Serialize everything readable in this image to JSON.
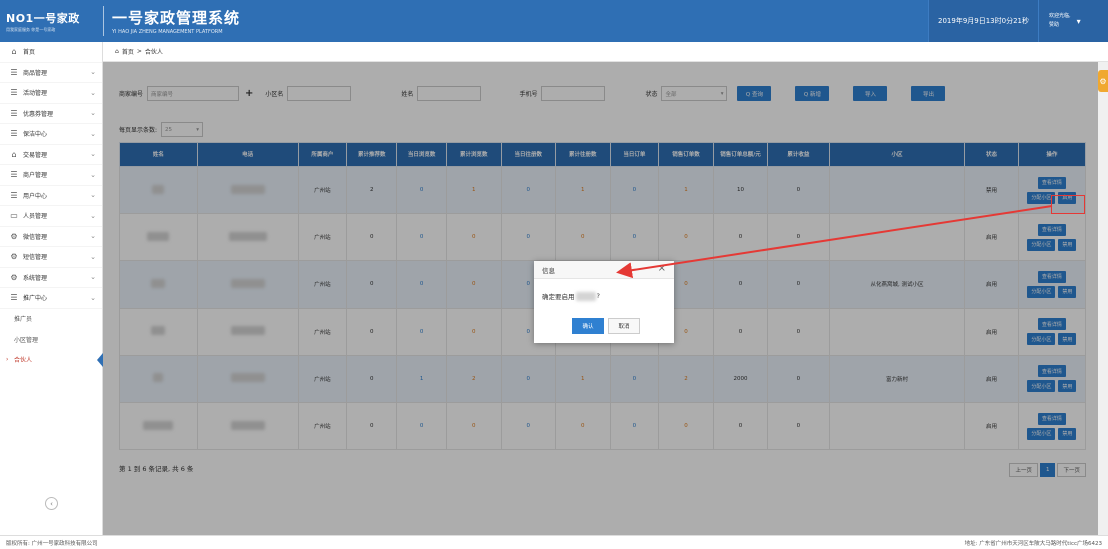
{
  "header": {
    "logo_text": "NO1一号家政",
    "logo_slogan": "用我家庭服务 你是一号家政",
    "system_title": "一号家政管理系统",
    "system_subtitle": "YI HAO JIA ZHENG MANAGEMENT PLATFORM",
    "datetime": "2019年9月9日13时0分21秒",
    "user_greeting": "欢迎光临,",
    "user_name": "赞助"
  },
  "sidebar": {
    "items": [
      {
        "label": "首页",
        "icon": "home-icon",
        "has_chevron": false
      },
      {
        "label": "商品管理",
        "icon": "list-icon",
        "has_chevron": true
      },
      {
        "label": "活动管理",
        "icon": "list-icon",
        "has_chevron": true
      },
      {
        "label": "优惠券管理",
        "icon": "list-icon",
        "has_chevron": true
      },
      {
        "label": "保洁中心",
        "icon": "list-icon",
        "has_chevron": true
      },
      {
        "label": "交易管理",
        "icon": "home-icon",
        "has_chevron": true
      },
      {
        "label": "商户管理",
        "icon": "list-icon",
        "has_chevron": true
      },
      {
        "label": "用户中心",
        "icon": "list-icon",
        "has_chevron": true
      },
      {
        "label": "人员管理",
        "icon": "monitor-icon",
        "has_chevron": true
      },
      {
        "label": "微信管理",
        "icon": "gears-icon",
        "has_chevron": true
      },
      {
        "label": "短信管理",
        "icon": "gears-icon",
        "has_chevron": true
      },
      {
        "label": "系统管理",
        "icon": "gears-icon",
        "has_chevron": true
      },
      {
        "label": "推广中心",
        "icon": "list-icon",
        "has_chevron": true
      }
    ],
    "sub_items": [
      {
        "label": "推广员"
      },
      {
        "label": "小区管理"
      },
      {
        "label": "合伙人"
      }
    ]
  },
  "breadcrumb": {
    "home": "首页",
    "separator": ">",
    "current": "合伙人"
  },
  "filters": {
    "merchant_no_label": "商家编号",
    "merchant_no_placeholder": "商家编号",
    "plus": "+",
    "community_label": "小区名",
    "name_label": "姓名",
    "phone_label": "手机号",
    "status_label": "状态",
    "status_value": "全部",
    "search_button": "Q 查询",
    "add_button": "Q 新增",
    "import_button": "导入",
    "export_button": "导出"
  },
  "pagesize": {
    "label": "每页显示条数:",
    "value": "25"
  },
  "table": {
    "headers": [
      "姓名",
      "电话",
      "所属商户",
      "累计推荐数",
      "当日浏览数",
      "累计浏览数",
      "当日往册数",
      "累计往册数",
      "当日订单",
      "销售订单数",
      "销售订单总额/元",
      "累计收益",
      "小区",
      "状态",
      "操作"
    ],
    "rows": [
      {
        "merchant": "广州站",
        "v1": "2",
        "v2": "0",
        "v3": "1",
        "v4": "0",
        "v5": "1",
        "v6": "0",
        "v7": "1",
        "total": "10",
        "income": "0",
        "community": "",
        "status": "禁用",
        "toggle": "启用"
      },
      {
        "merchant": "广州站",
        "v1": "0",
        "v2": "0",
        "v3": "0",
        "v4": "0",
        "v5": "0",
        "v6": "0",
        "v7": "0",
        "total": "0",
        "income": "0",
        "community": "",
        "status": "启用",
        "toggle": "禁用"
      },
      {
        "merchant": "广州站",
        "v1": "0",
        "v2": "0",
        "v3": "0",
        "v4": "0",
        "v5": "0",
        "v6": "0",
        "v7": "0",
        "total": "0",
        "income": "0",
        "community": "从化燕窝城, 测试小区",
        "status": "启用",
        "toggle": "禁用"
      },
      {
        "merchant": "广州站",
        "v1": "0",
        "v2": "0",
        "v3": "0",
        "v4": "0",
        "v5": "0",
        "v6": "0",
        "v7": "0",
        "total": "0",
        "income": "0",
        "community": "",
        "status": "启用",
        "toggle": "禁用"
      },
      {
        "merchant": "广州站",
        "v1": "0",
        "v2": "1",
        "v3": "2",
        "v4": "0",
        "v5": "1",
        "v6": "0",
        "v7": "2",
        "total": "2000",
        "income": "0",
        "community": "富力新村",
        "status": "启用",
        "toggle": "禁用"
      },
      {
        "merchant": "广州站",
        "v1": "0",
        "v2": "0",
        "v3": "0",
        "v4": "0",
        "v5": "0",
        "v6": "0",
        "v7": "0",
        "total": "0",
        "income": "0",
        "community": "",
        "status": "启用",
        "toggle": "禁用"
      }
    ],
    "op_detail": "查看详情",
    "op_assign": "分配小区"
  },
  "footer_info": "第 1 到 6 条记录, 共 6 条",
  "pager": {
    "prev": "上一页",
    "current": "1",
    "next": "下一页"
  },
  "dialog": {
    "title": "信息",
    "close": "×",
    "message_prefix": "确定要启用",
    "message_suffix": "?",
    "confirm": "确认",
    "cancel": "取消"
  },
  "page_footer": {
    "left": "版权所有: 广州一号家政科技有限公司",
    "right": "地址: 广东省广州市天河区车陂大马路时代ticc广场6423"
  },
  "colors": {
    "brand": "#2f6fb4",
    "accent": "#2f80d1",
    "annotation": "#e53935"
  }
}
